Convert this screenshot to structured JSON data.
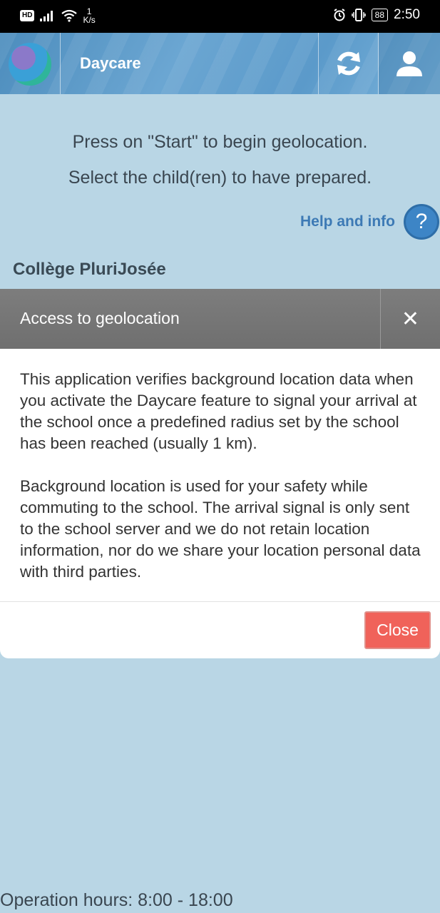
{
  "status_bar": {
    "hd": "HD",
    "speed_value": "1",
    "speed_unit": "K/s",
    "battery": "88",
    "time": "2:50"
  },
  "header": {
    "title": "Daycare",
    "icons": [
      "logo-icon",
      "refresh-icon",
      "user-icon"
    ]
  },
  "instructions": {
    "line1": "Press on \"Start\" to begin geolocation.",
    "line2": "Select the child(ren) to have prepared."
  },
  "help": {
    "label": "Help and info",
    "icon": "?"
  },
  "school_name": "Collège PluriJosée",
  "modal": {
    "title": "Access to geolocation",
    "close_icon": "✕",
    "paragraph1": "This application verifies background location data when you activate the Daycare feature to signal your arrival at the school once a predefined radius set by the school has been reached (usually 1 km).",
    "paragraph2": "Background location is used for your safety while commuting to the school. The arrival signal is only sent to the school server and we do not retain location information, nor do we share your location personal data with third parties.",
    "close_button": "Close"
  },
  "footer": {
    "hours": "Operation hours: 8:00 - 18:00"
  },
  "colors": {
    "page_bg": "#b9d6e5",
    "header_bg": "#5b9aca",
    "modal_header": "#777777",
    "close_button": "#f0625a",
    "help_link": "#3d7ab5"
  }
}
